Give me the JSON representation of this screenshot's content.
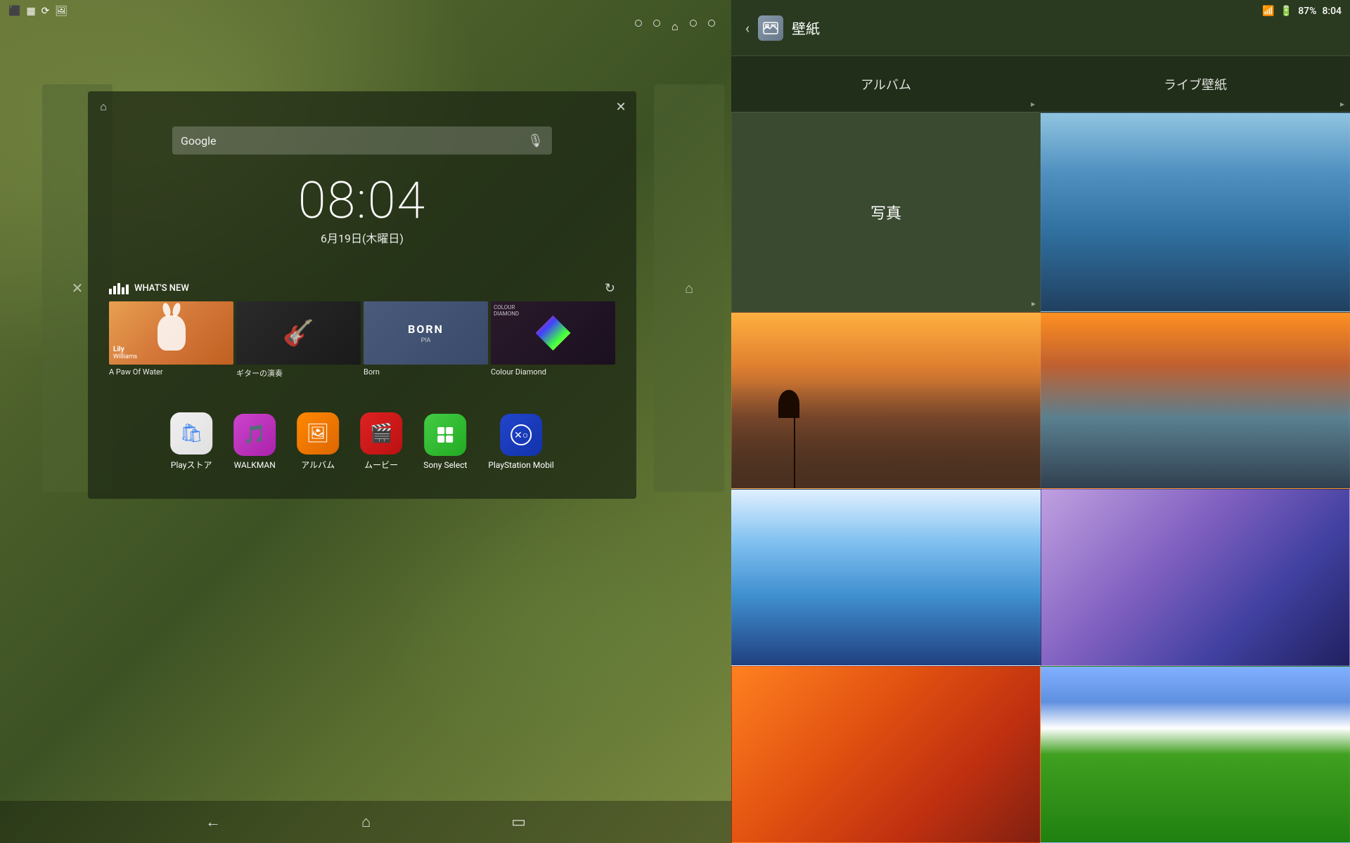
{
  "statusBar": {
    "time": "8:04",
    "battery": "87%",
    "icons": [
      "screen",
      "grid",
      "signal",
      "image"
    ]
  },
  "navigation": {
    "dots": [
      "dot1",
      "dot2",
      "home",
      "dot4",
      "dot5"
    ],
    "activeIndex": 2
  },
  "window": {
    "closeLabel": "✕",
    "homeLabel": "⌂"
  },
  "search": {
    "placeholder": "Google",
    "micLabel": "🎙"
  },
  "clock": {
    "time": "08:04",
    "date": "6月19日(木曜日)"
  },
  "whatsNew": {
    "title": "WHAT'S NEW",
    "refreshLabel": "↻",
    "albums": [
      {
        "title": "A Paw Of Water",
        "type": "paw"
      },
      {
        "title": "ギターの演奏",
        "type": "guitar"
      },
      {
        "title": "Born",
        "type": "born"
      },
      {
        "title": "Colour Diamond",
        "type": "colour"
      }
    ]
  },
  "apps": [
    {
      "name": "Playストア",
      "type": "playstore"
    },
    {
      "name": "WALKMAN",
      "type": "walkman"
    },
    {
      "name": "アルバム",
      "type": "album"
    },
    {
      "name": "ムービー",
      "type": "movie"
    },
    {
      "name": "Sony Select",
      "type": "sonyselect"
    },
    {
      "name": "PlayStation Mobil",
      "type": "playstation"
    }
  ],
  "navBar": {
    "backLabel": "←",
    "homeLabel": "⌂",
    "recentLabel": "▭"
  },
  "wallpaperPanel": {
    "title": "壁紙",
    "backLabel": "‹",
    "categories": [
      {
        "label": "アルバム"
      },
      {
        "label": "ライブ壁紙"
      }
    ],
    "photoLabel": "写真",
    "wallpapers": [
      {
        "type": "water",
        "label": ""
      },
      {
        "type": "sunset",
        "label": ""
      },
      {
        "type": "coast",
        "label": ""
      },
      {
        "type": "sky-blue",
        "label": ""
      },
      {
        "type": "purple-mtn",
        "label": ""
      },
      {
        "type": "orange",
        "label": ""
      },
      {
        "type": "grass",
        "label": ""
      }
    ]
  }
}
